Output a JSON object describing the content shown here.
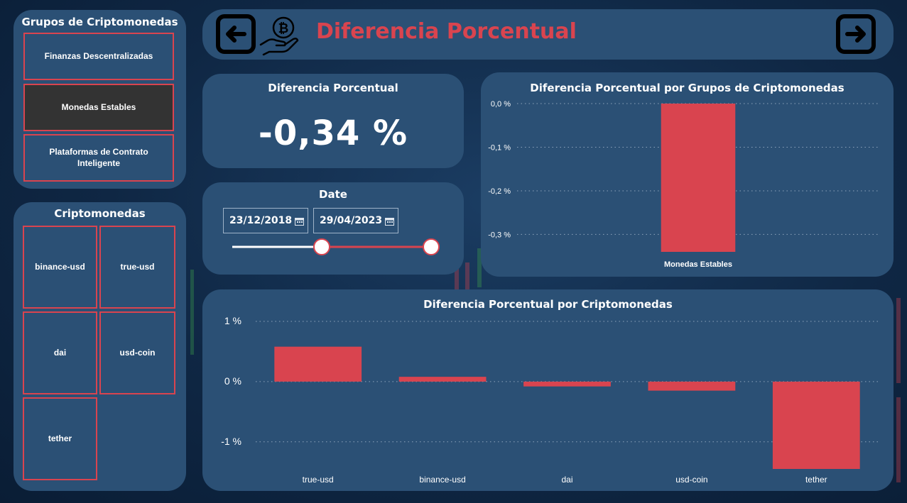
{
  "header": {
    "title": "Diferencia Porcentual",
    "title_color": "#d9444f",
    "back_icon": "arrow-left-icon",
    "forward_icon": "arrow-right-icon",
    "logo_icon": "bitcoin-hand-icon"
  },
  "groups_slicer": {
    "title": "Grupos de Criptomonedas",
    "items": [
      {
        "label": "Finanzas Descentralizadas",
        "selected": false
      },
      {
        "label": "Monedas Estables",
        "selected": true
      },
      {
        "label": "Plataformas de Contrato Inteligente",
        "selected": false
      }
    ]
  },
  "coins_slicer": {
    "title": "Criptomonedas",
    "items": [
      "binance-usd",
      "true-usd",
      "dai",
      "usd-coin",
      "tether"
    ]
  },
  "kpi": {
    "title": "Diferencia Porcentual",
    "value": "-0,34 %"
  },
  "date_slicer": {
    "title": "Date",
    "start": "23/12/2018",
    "end": "29/04/2023",
    "range_fraction": [
      0.45,
      1.0
    ]
  },
  "colors": {
    "panel": "#2b5075",
    "accent": "#d9444f",
    "selected": "#333333"
  },
  "chart_data": [
    {
      "type": "bar",
      "title": "Diferencia Porcentual por Grupos de Criptomonedas",
      "categories": [
        "Monedas Estables"
      ],
      "values": [
        -0.34
      ],
      "ylim": [
        -0.34,
        0.0
      ],
      "yticks": [
        0.0,
        -0.1,
        -0.2,
        -0.3
      ],
      "ytick_labels": [
        "0,0 %",
        "-0,1 %",
        "-0,2 %",
        "-0,3 %"
      ],
      "color": "#d9444f",
      "grid": true
    },
    {
      "type": "bar",
      "title": "Diferencia Porcentual por Criptomonedas",
      "categories": [
        "true-usd",
        "binance-usd",
        "dai",
        "usd-coin",
        "tether"
      ],
      "values": [
        0.58,
        0.08,
        -0.08,
        -0.15,
        -1.45
      ],
      "ylim": [
        -1.45,
        1.0
      ],
      "yticks": [
        1,
        0,
        -1
      ],
      "ytick_labels": [
        "1 %",
        "0 %",
        "-1 %"
      ],
      "color": "#d9444f",
      "grid": true
    }
  ]
}
